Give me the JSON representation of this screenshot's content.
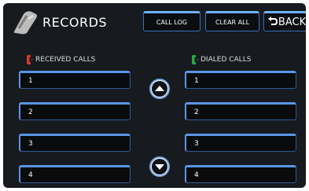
{
  "header": {
    "title": "RECORDS",
    "buttons": {
      "call_log": "CALL LOG",
      "clear_all": "CLEAR ALL",
      "back": "BACK"
    }
  },
  "received": {
    "title": "RECEIVED CALLS",
    "entries": [
      "1",
      "2",
      "3",
      "4"
    ]
  },
  "dialed": {
    "title": "DIALED CALLS",
    "entries": [
      "1",
      "2",
      "3",
      "4"
    ]
  },
  "colors": {
    "received_icon": "#d63a2e",
    "dialed_icon": "#2aa84a",
    "accent": "#5a96e6",
    "background": "#171a1e"
  }
}
